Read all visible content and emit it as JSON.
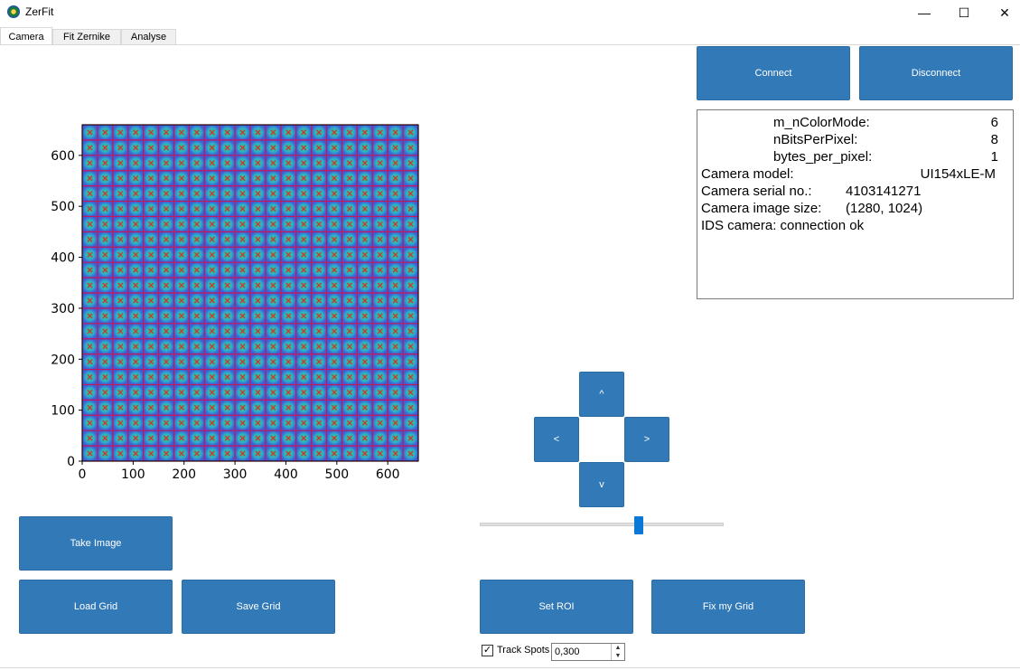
{
  "window": {
    "title": "ZerFit",
    "minimize_glyph": "—",
    "maximize_glyph": "☐",
    "close_glyph": "✕"
  },
  "tabs": [
    {
      "label": "Camera",
      "active": true
    },
    {
      "label": "Fit Zernike",
      "active": false
    },
    {
      "label": "Analyse",
      "active": false
    }
  ],
  "buttons": {
    "connect": "Connect",
    "disconnect": "Disconnect",
    "take_image": "Take Image",
    "load_grid": "Load Grid",
    "save_grid": "Save Grid",
    "set_roi": "Set ROI",
    "fix_my_grid": "Fix my Grid",
    "up": "^",
    "left": "<",
    "right": ">",
    "down": "v"
  },
  "info": {
    "color_mode_label": "m_nColorMode:",
    "color_mode_value": "6",
    "bits_label": "nBitsPerPixel:",
    "bits_value": "8",
    "bytes_label": "bytes_per_pixel:",
    "bytes_value": "1",
    "model_label": "Camera model:",
    "model_value": "UI154xLE-M",
    "serial_label": "Camera serial no.:",
    "serial_value": "4103141271",
    "size_label": "Camera image size:",
    "size_value": "(1280, 1024)",
    "status": "IDS camera: connection ok"
  },
  "track_spots": {
    "label": "Track Spots",
    "checked": true,
    "check_glyph": "✓",
    "value": "0,300",
    "up_glyph": "▲",
    "down_glyph": "▼"
  },
  "slider": {
    "value": 0.65
  },
  "colors": {
    "button": "#3279b7",
    "spot_bg": "#3b5fd6",
    "spot_center": "#39c46a",
    "grid_line": "#c2185b",
    "marker": "#d32f2f"
  },
  "icons": {
    "app": "zerfit-app-icon",
    "up": "chevron-up-icon",
    "left": "chevron-left-icon",
    "right": "chevron-right-icon",
    "down": "chevron-down-icon"
  },
  "chart_data": {
    "type": "heatmap",
    "description_of_content": "",
    "xlim": [
      0,
      660
    ],
    "ylim": [
      0,
      660
    ],
    "x_ticks": [
      0,
      100,
      200,
      300,
      400,
      500,
      600
    ],
    "y_ticks": [
      0,
      100,
      200,
      300,
      400,
      500,
      600
    ],
    "grid_cells_per_side": 22,
    "grid_on": true
  }
}
